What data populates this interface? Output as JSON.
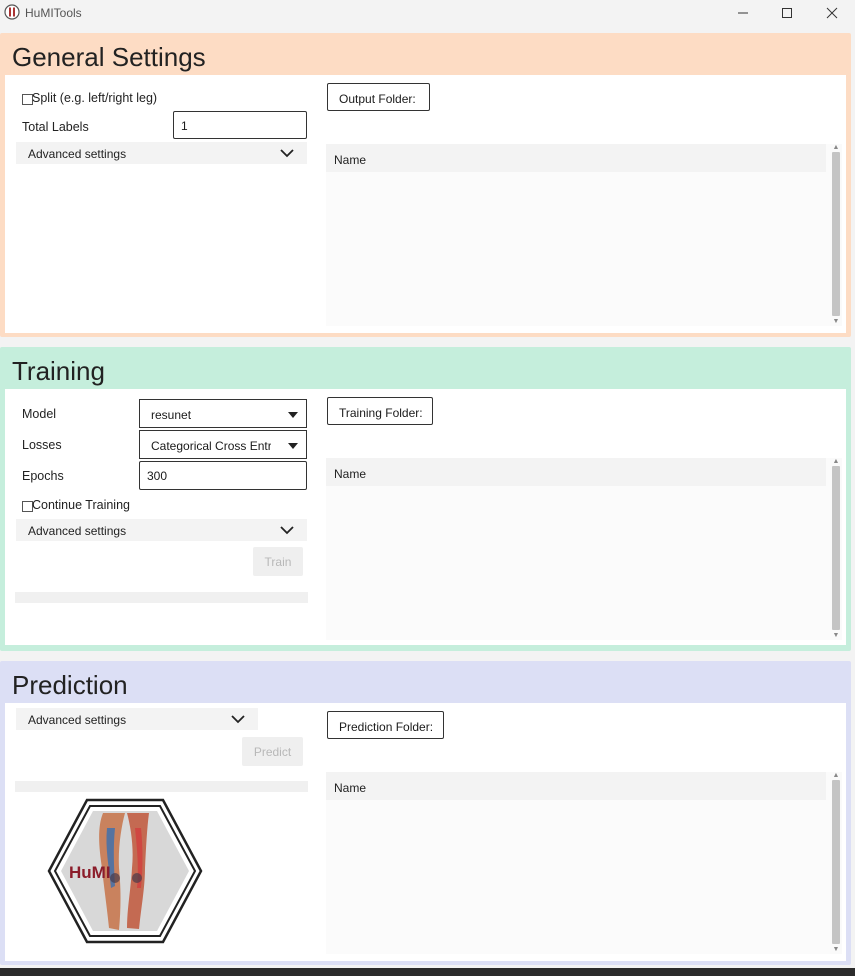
{
  "window": {
    "title": "HuMITools",
    "minimize_glyph": "—",
    "maximize_glyph": "☐",
    "close_glyph": "✕"
  },
  "general": {
    "title": "General Settings",
    "color": "#fddcc4",
    "split_label": "Split (e.g. left/right leg)",
    "split_checked": false,
    "total_labels_label": "Total Labels",
    "total_labels_value": "1",
    "advanced_label": "Advanced settings",
    "output_button": "Output Folder:",
    "list_header": "Name"
  },
  "training": {
    "title": "Training",
    "color": "#c5eedc",
    "model_label": "Model",
    "model_value": "resunet",
    "losses_label": "Losses",
    "losses_value": "Categorical Cross Entropy",
    "epochs_label": "Epochs",
    "epochs_value": "300",
    "continue_label": "Continue Training",
    "continue_checked": false,
    "advanced_label": "Advanced settings",
    "train_button": "Train",
    "training_folder_button": "Training Folder:",
    "list_header": "Name"
  },
  "prediction": {
    "title": "Prediction",
    "color": "#dcdff5",
    "advanced_label": "Advanced settings",
    "predict_button": "Predict",
    "prediction_folder_button": "Prediction Folder:",
    "list_header": "Name",
    "logo_text": "HuMI"
  }
}
